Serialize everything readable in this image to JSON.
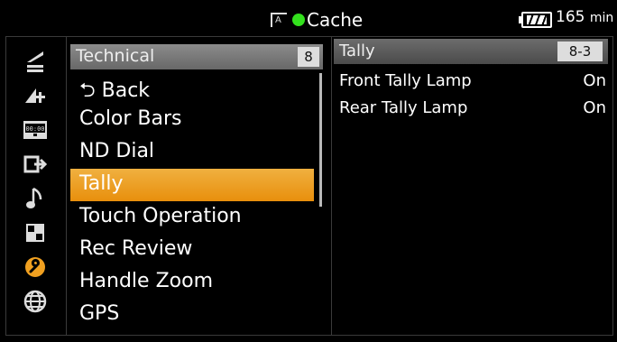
{
  "status_bar": {
    "cache_label": "Cache",
    "cache_indicator_color": "#33e01d",
    "remaining_time": "165",
    "remaining_unit": "min"
  },
  "sidebar_icons": [
    "shooting-icon",
    "recording-settings-icon",
    "timecode-icon",
    "output-icon",
    "audio-icon",
    "thumbnail-icon",
    "technical-icon",
    "network-icon"
  ],
  "menu": {
    "title": "Technical",
    "page_number": "8",
    "items": [
      {
        "label": "Back",
        "glyph": "⮌"
      },
      {
        "label": "Color Bars"
      },
      {
        "label": "ND Dial"
      },
      {
        "label": "Tally"
      },
      {
        "label": "Touch Operation"
      },
      {
        "label": "Rec Review"
      },
      {
        "label": "Handle Zoom"
      },
      {
        "label": "GPS"
      }
    ],
    "selected": "Tally",
    "accent_color": "#e88f0c"
  },
  "detail": {
    "title": "Tally",
    "page_number": "8-3",
    "rows": [
      {
        "label": "Front Tally Lamp",
        "value": "On"
      },
      {
        "label": "Rear Tally Lamp",
        "value": "On"
      }
    ]
  }
}
